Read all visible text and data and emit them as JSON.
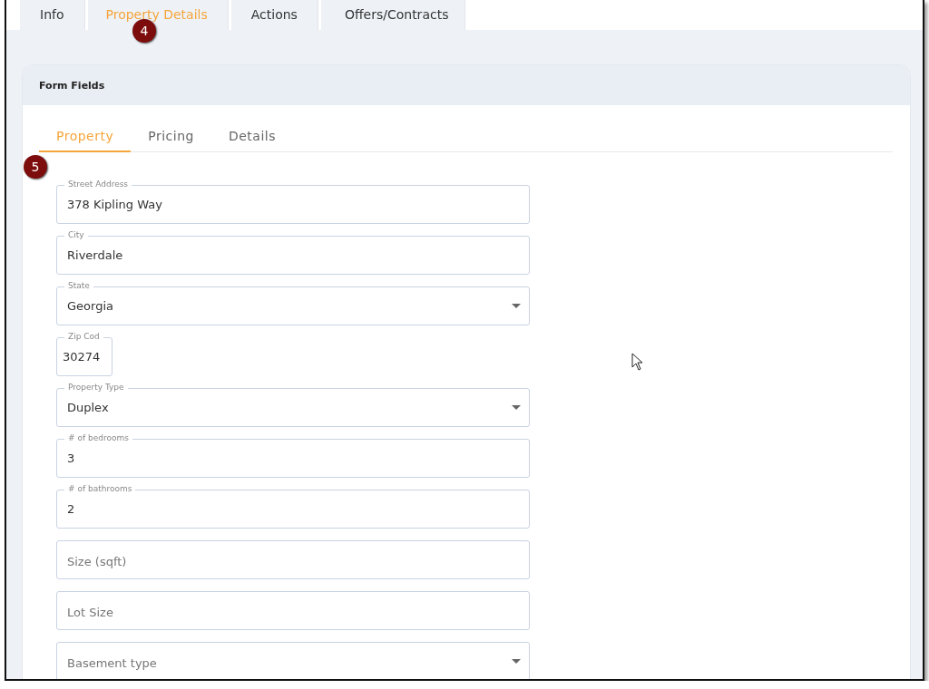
{
  "tabs": [
    {
      "label": "Info",
      "selected": false
    },
    {
      "label": "Property Details",
      "selected": true
    },
    {
      "label": "Actions",
      "selected": false
    },
    {
      "label": "Offers/Contracts",
      "selected": false
    }
  ],
  "card": {
    "title": "Form Fields",
    "subtabs": [
      {
        "label": "Property",
        "selected": true
      },
      {
        "label": "Pricing",
        "selected": false
      },
      {
        "label": "Details",
        "selected": false
      }
    ],
    "fields": [
      {
        "kind": "text",
        "label": "Street Address",
        "value": "378 Kipling Way"
      },
      {
        "kind": "text",
        "label": "City",
        "value": "Riverdale"
      },
      {
        "kind": "select",
        "label": "State",
        "value": "Georgia"
      },
      {
        "kind": "short",
        "label": "Zip Cod",
        "value": "30274"
      },
      {
        "kind": "select",
        "label": "Property Type",
        "value": "Duplex"
      },
      {
        "kind": "text",
        "label": "# of bedrooms",
        "value": "3"
      },
      {
        "kind": "text",
        "label": "# of bathrooms",
        "value": "2"
      },
      {
        "kind": "text",
        "placeholder": "Size (sqft)"
      },
      {
        "kind": "text",
        "placeholder": "Lot Size"
      },
      {
        "kind": "select",
        "placeholder": "Basement type"
      }
    ]
  },
  "callouts": [
    "4",
    "5"
  ]
}
